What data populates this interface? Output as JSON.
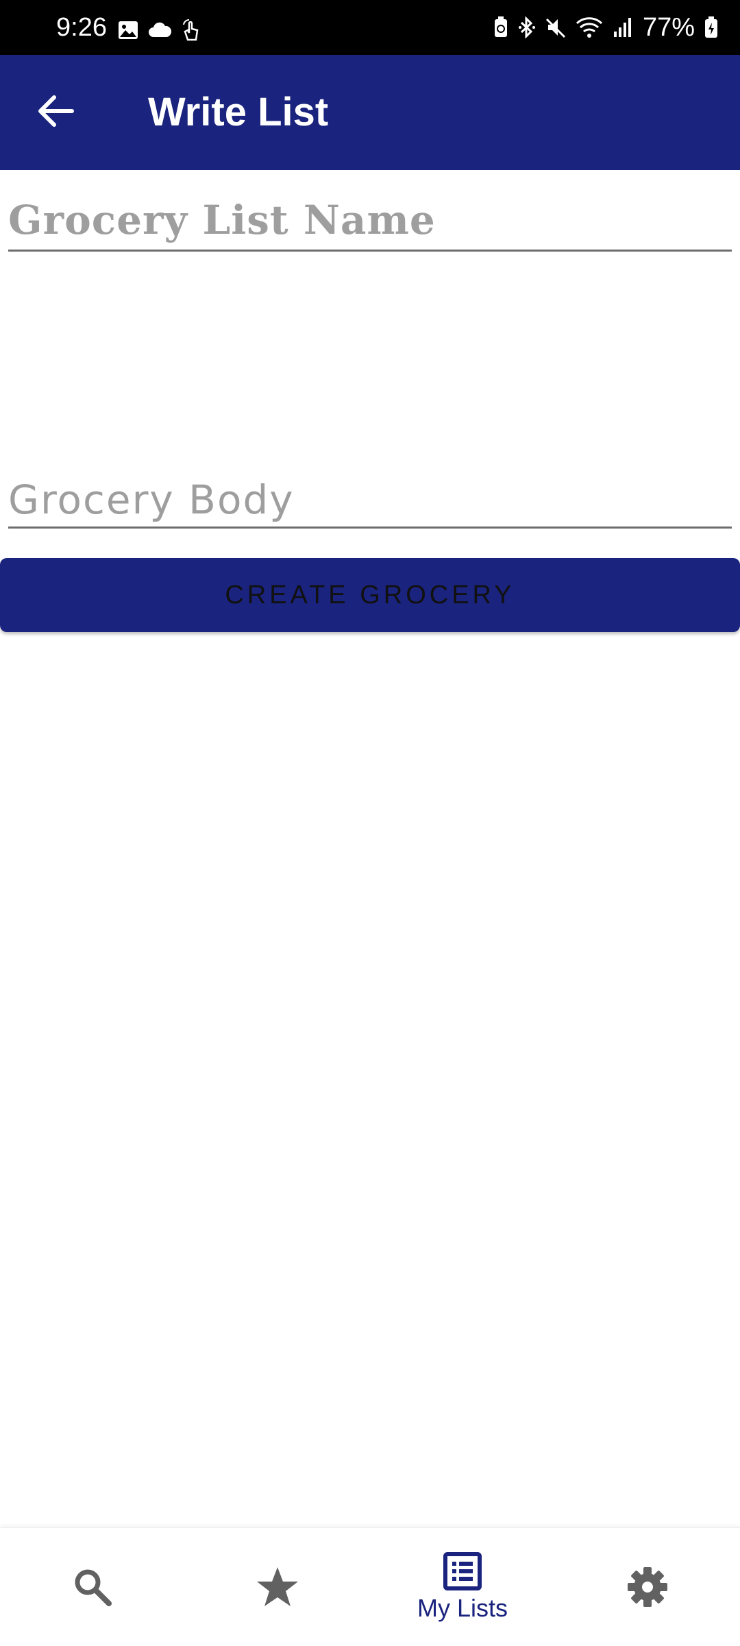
{
  "status_bar": {
    "time": "9:26",
    "battery": "77%",
    "icons": [
      "gallery-icon",
      "cloud-icon",
      "gesture-icon",
      "battery-saver-icon",
      "bluetooth-icon",
      "mute-icon",
      "wifi-icon",
      "signal-icon",
      "battery-icon"
    ]
  },
  "app_bar": {
    "title": "Write List",
    "back_icon": "arrow-back-icon"
  },
  "form": {
    "name_field": {
      "value": "",
      "placeholder": "Grocery List Name"
    },
    "body_field": {
      "value": "",
      "placeholder": "Grocery Body"
    },
    "create_button": "CREATE GROCERY"
  },
  "bottom_nav": {
    "items": [
      {
        "icon": "search-icon",
        "label": ""
      },
      {
        "icon": "star-icon",
        "label": ""
      },
      {
        "icon": "list-icon",
        "label": "My Lists",
        "active": true
      },
      {
        "icon": "gear-icon",
        "label": ""
      }
    ]
  },
  "colors": {
    "primary": "#1a237e",
    "status_bar": "#000000",
    "inactive_icon": "#616161",
    "placeholder": "#9e9e9e"
  }
}
